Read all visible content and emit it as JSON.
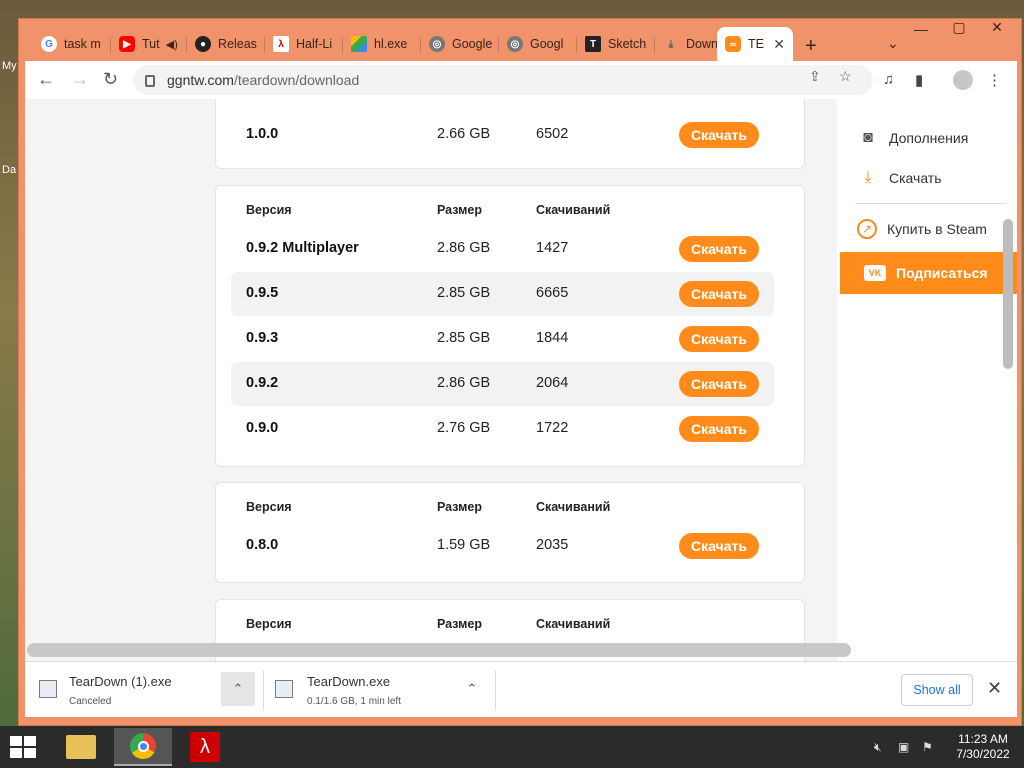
{
  "desktop": {
    "icon_labels": [
      "My",
      "Da"
    ]
  },
  "browser": {
    "tabs": [
      {
        "label": "task m",
        "icon": "google-icon"
      },
      {
        "label": "Tut",
        "icon": "youtube-icon"
      },
      {
        "label": "Releas",
        "icon": "github-icon"
      },
      {
        "label": "Half-Li",
        "icon": "half-life-icon"
      },
      {
        "label": "hl.exe",
        "icon": "drive-icon"
      },
      {
        "label": "Google",
        "icon": "globe-icon"
      },
      {
        "label": "Googl",
        "icon": "globe-icon"
      },
      {
        "label": "Sketch",
        "icon": "t-icon"
      },
      {
        "label": "Downl",
        "icon": "download-icon"
      },
      {
        "label": "TE",
        "icon": "gamepad-icon",
        "active": true
      }
    ],
    "new_tab_label": "+",
    "address": {
      "host": "ggntw.com",
      "path": "/teardown/download"
    }
  },
  "page": {
    "top_card": {
      "row": {
        "version": "1.0.0",
        "size": "2.66 GB",
        "downloads": "6502",
        "button": "Скачать"
      }
    },
    "cards": [
      {
        "headers": {
          "version": "Версия",
          "size": "Размер",
          "downloads": "Скачиваний"
        },
        "rows": [
          {
            "version": "0.9.2 Multiplayer",
            "size": "2.86 GB",
            "downloads": "1427",
            "button": "Скачать"
          },
          {
            "version": "0.9.5",
            "size": "2.85 GB",
            "downloads": "6665",
            "button": "Скачать"
          },
          {
            "version": "0.9.3",
            "size": "2.85 GB",
            "downloads": "1844",
            "button": "Скачать"
          },
          {
            "version": "0.9.2",
            "size": "2.86 GB",
            "downloads": "2064",
            "button": "Скачать"
          },
          {
            "version": "0.9.0",
            "size": "2.76 GB",
            "downloads": "1722",
            "button": "Скачать"
          }
        ]
      },
      {
        "headers": {
          "version": "Версия",
          "size": "Размер",
          "downloads": "Скачиваний"
        },
        "rows": [
          {
            "version": "0.8.0",
            "size": "1.59 GB",
            "downloads": "2035",
            "button": "Скачать"
          }
        ]
      },
      {
        "headers": {
          "version": "Версия",
          "size": "Размер",
          "downloads": "Скачиваний"
        },
        "rows": []
      }
    ],
    "sidebar": {
      "items": [
        {
          "label": "Дополнения",
          "icon": "gamepad-icon"
        },
        {
          "label": "Скачать",
          "icon": "download-icon"
        },
        {
          "label": "Купить в Steam",
          "icon": "arrow-up-right-icon"
        }
      ],
      "subscribe": {
        "label": "Подписаться",
        "icon": "vk-icon",
        "icon_text": "VK"
      }
    },
    "accent_color": "#ff8c1a"
  },
  "downloads_shelf": {
    "items": [
      {
        "name": "TearDown (1).exe",
        "status": "Canceled"
      },
      {
        "name": "TearDown.exe",
        "status": "0.1/1.6 GB, 1 min left"
      }
    ],
    "show_all": "Show all"
  },
  "taskbar": {
    "time": "11:23 AM",
    "date": "7/30/2022"
  }
}
